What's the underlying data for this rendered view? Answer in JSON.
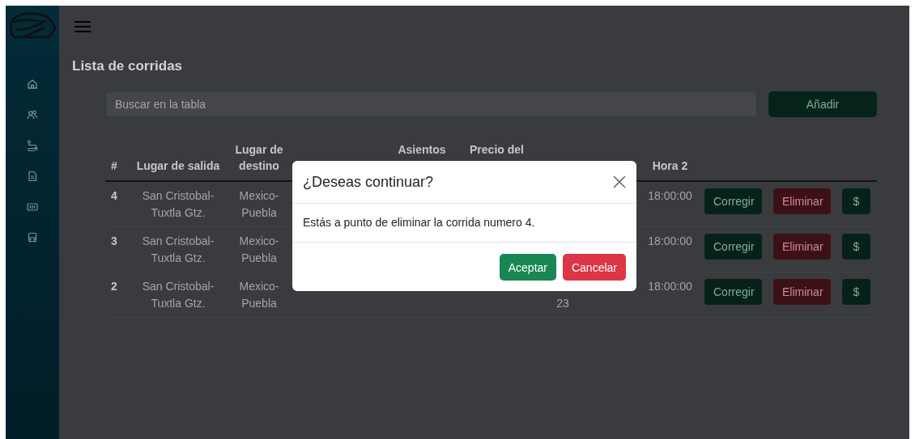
{
  "page": {
    "title": "Lista de corridas"
  },
  "search": {
    "placeholder": "Buscar en la tabla"
  },
  "add_button": {
    "label": "Añadir"
  },
  "table": {
    "columns": [
      {
        "label": "#"
      },
      {
        "label": "Lugar de salida"
      },
      {
        "label": "Lugar de destino"
      },
      {
        "label": "Asientos"
      },
      {
        "label": "Precio del"
      },
      {
        "label": "Hora 2"
      }
    ],
    "rows": [
      {
        "number": "4",
        "origin": "San Cristobal-Tuxtla Gtz.",
        "destination": "Mexico-Puebla",
        "hora_2": "18:00:00",
        "actions": [
          {
            "label": "Corregir",
            "kind": "edit"
          },
          {
            "label": "Eliminar",
            "kind": "delete"
          },
          {
            "label": "$",
            "kind": "pay"
          }
        ]
      },
      {
        "number": "3",
        "origin": "San Cristobal-Tuxtla Gtz.",
        "destination": "Mexico-Puebla",
        "hora_2": "18:00:00",
        "actions": [
          {
            "label": "Corregir",
            "kind": "edit"
          },
          {
            "label": "Eliminar",
            "kind": "delete"
          },
          {
            "label": "$",
            "kind": "pay"
          }
        ]
      },
      {
        "number": "2",
        "origin": "San Cristobal-Tuxtla Gtz.",
        "destination": "Mexico-Puebla",
        "column_7": "23",
        "hora_2": "18:00:00",
        "actions": [
          {
            "label": "Corregir",
            "kind": "edit"
          },
          {
            "label": "Eliminar",
            "kind": "delete"
          },
          {
            "label": "$",
            "kind": "pay"
          }
        ]
      }
    ]
  },
  "modal": {
    "title": "¿Deseas continuar?",
    "message": "Estás a punto de eliminar la corrida numero 4.",
    "buttons": [
      {
        "label": "Aceptar",
        "kind": "confirm"
      },
      {
        "label": "Cancelar",
        "kind": "cancel"
      }
    ]
  }
}
